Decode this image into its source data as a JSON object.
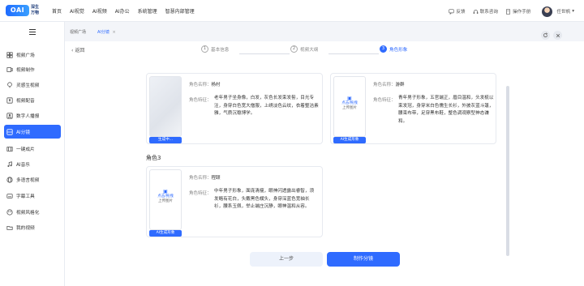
{
  "logo": {
    "mark": "OAI",
    "line1": "深生",
    "line2": "万物"
  },
  "nav": [
    "首页",
    "AI视觉",
    "AI视频",
    "AI办公",
    "系统管理",
    "智慧内部管理"
  ],
  "header_right": {
    "feedback": "反馈",
    "contact": "联系咨询",
    "manual": "操作手册",
    "username": "任世帆"
  },
  "sidebar": {
    "items": [
      {
        "label": "视频广场",
        "icon": "grid-icon"
      },
      {
        "label": "视频制作",
        "icon": "video-icon"
      },
      {
        "label": "灵感生视频",
        "icon": "bulb-icon"
      },
      {
        "label": "视频配音",
        "icon": "mic-icon"
      },
      {
        "label": "数字人播报",
        "icon": "person-icon"
      },
      {
        "label": "AI分镜",
        "icon": "storyboard-icon",
        "active": true
      },
      {
        "label": "一键成片",
        "icon": "film-icon"
      },
      {
        "label": "AI音乐",
        "icon": "music-icon"
      },
      {
        "label": "多语言视频",
        "icon": "language-icon"
      },
      {
        "label": "字幕工具",
        "icon": "subtitle-icon"
      },
      {
        "label": "视频风格化",
        "icon": "palette-icon"
      },
      {
        "label": "我的视频",
        "icon": "folder-icon"
      }
    ]
  },
  "tabs": [
    {
      "label": "视频广场"
    },
    {
      "label": "AI分镜",
      "active": true
    }
  ],
  "back_label": "返回",
  "steps": [
    {
      "num": "1",
      "label": "基本信息"
    },
    {
      "num": "2",
      "label": "视频大纲"
    },
    {
      "num": "3",
      "label": "角色形象",
      "active": true
    }
  ],
  "field_labels": {
    "name": "角色名称：",
    "trait": "角色特征："
  },
  "upload": {
    "link": "点击/拖拽",
    "hint": "上传图片"
  },
  "section_title_3": "角色3",
  "characters": [
    {
      "name": "杨村",
      "trait": "老年男子坐身像，白发，灰色长发束发髻，目光专注，身穿白色宽大僧服，上绣淡色云纹，衣着整洁素雅，气质沉稳博学。",
      "button": "生成中..."
    },
    {
      "name": "游群",
      "trait": "青年男子形象，五官端正，眉目温和，头发梳以束发冠，身穿米白色儒生长衫，外披灰蓝斗篷，腰束布带，足穿黑布鞋，整色调观察型神态谦和。",
      "button": "AI生成形象"
    },
    {
      "name": "程颐",
      "trait": "中年男子形象，面庞清瘦，眼神闪透露出睿智，须发略有花白，头戴黑色幞头，身穿深蓝色宽袖长衫，腰系玉佩，举止端庄沉静，眼神温和从容。",
      "button": "AI生成形象"
    }
  ],
  "buttons": {
    "prev": "上一步",
    "next": "制作分镜"
  },
  "colors": {
    "accent": "#2f6bff",
    "background": "#f3f5f9"
  }
}
